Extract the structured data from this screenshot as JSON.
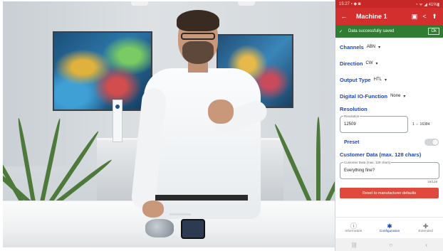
{
  "status_bar": {
    "time": "15:27 ▪ ◆ ◙",
    "icons": "◔ ᯤ ◢ 41%▮"
  },
  "app_bar": {
    "title": "Machine 1",
    "back_icon": "arrow-left-icon",
    "save_icon": "save-icon",
    "share_icon": "share-icon",
    "more_icon": "upload-icon"
  },
  "snackbar": {
    "message": "Data successfully saved",
    "action": "Ok",
    "icon": "check-icon"
  },
  "settings": {
    "channels": {
      "label": "Channels",
      "value": "ABN"
    },
    "direction": {
      "label": "Direction",
      "value": "CW"
    },
    "output_type": {
      "label": "Output Type",
      "value": "HTL"
    },
    "digital_io": {
      "label": "Digital IO-Function",
      "value": "None"
    }
  },
  "resolution": {
    "section": "Resolution",
    "field_label": "Resolution",
    "value": "12509",
    "range": "1 ⇔ 16384"
  },
  "preset": {
    "label": "Preset",
    "enabled": false
  },
  "customer_data": {
    "section": "Customer Data (max. 128 chars)",
    "field_label": "Customer Data (max. 128 chars)",
    "value": "Everything fine?",
    "counter": "16/128"
  },
  "reset_button": {
    "label": "Reset to manufacturer defaults"
  },
  "bottom_nav": [
    {
      "label": "Information",
      "icon": "info-icon",
      "glyph": "ⓘ"
    },
    {
      "label": "Configuration",
      "icon": "gear-icon",
      "glyph": "✱"
    },
    {
      "label": "Extended",
      "icon": "puzzle-icon",
      "glyph": "✚"
    }
  ],
  "system_nav": {
    "recent": "|||",
    "home": "○",
    "back": "‹"
  },
  "colors": {
    "primary_red": "#d32f2f",
    "success_green": "#2e7d32",
    "label_blue": "#1f47b5",
    "reset_red": "#e04a3c"
  }
}
